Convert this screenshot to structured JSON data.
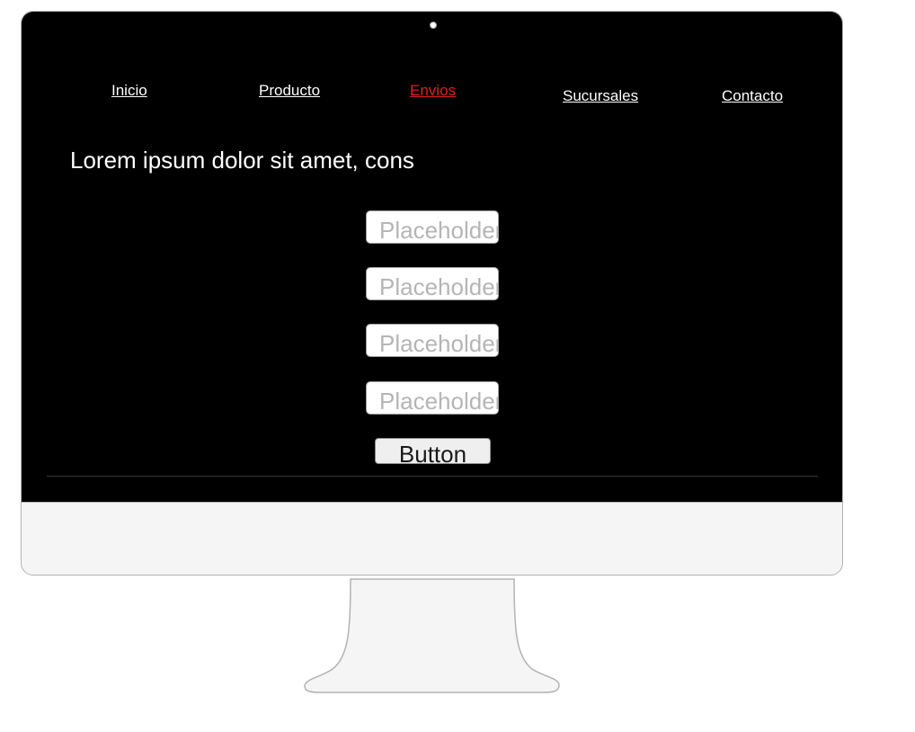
{
  "nav": {
    "items": [
      {
        "label": "Inicio"
      },
      {
        "label": "Producto"
      },
      {
        "label": "Envios"
      },
      {
        "label": "Sucursales"
      },
      {
        "label": "Contacto"
      }
    ],
    "active_index": 2
  },
  "main": {
    "headline": "Lorem ipsum dolor sit amet, cons"
  },
  "form": {
    "fields": [
      {
        "placeholder": "Placeholder",
        "value": ""
      },
      {
        "placeholder": "Placeholder",
        "value": ""
      },
      {
        "placeholder": "Placeholder",
        "value": ""
      },
      {
        "placeholder": "Placeholder",
        "value": ""
      }
    ],
    "button_label": "Button"
  },
  "colors": {
    "screen_background": "#000000",
    "link_text": "#ffffff",
    "active_link": "#e02020",
    "bezel": "#f5f5f5",
    "outline": "#b3b3b3"
  }
}
